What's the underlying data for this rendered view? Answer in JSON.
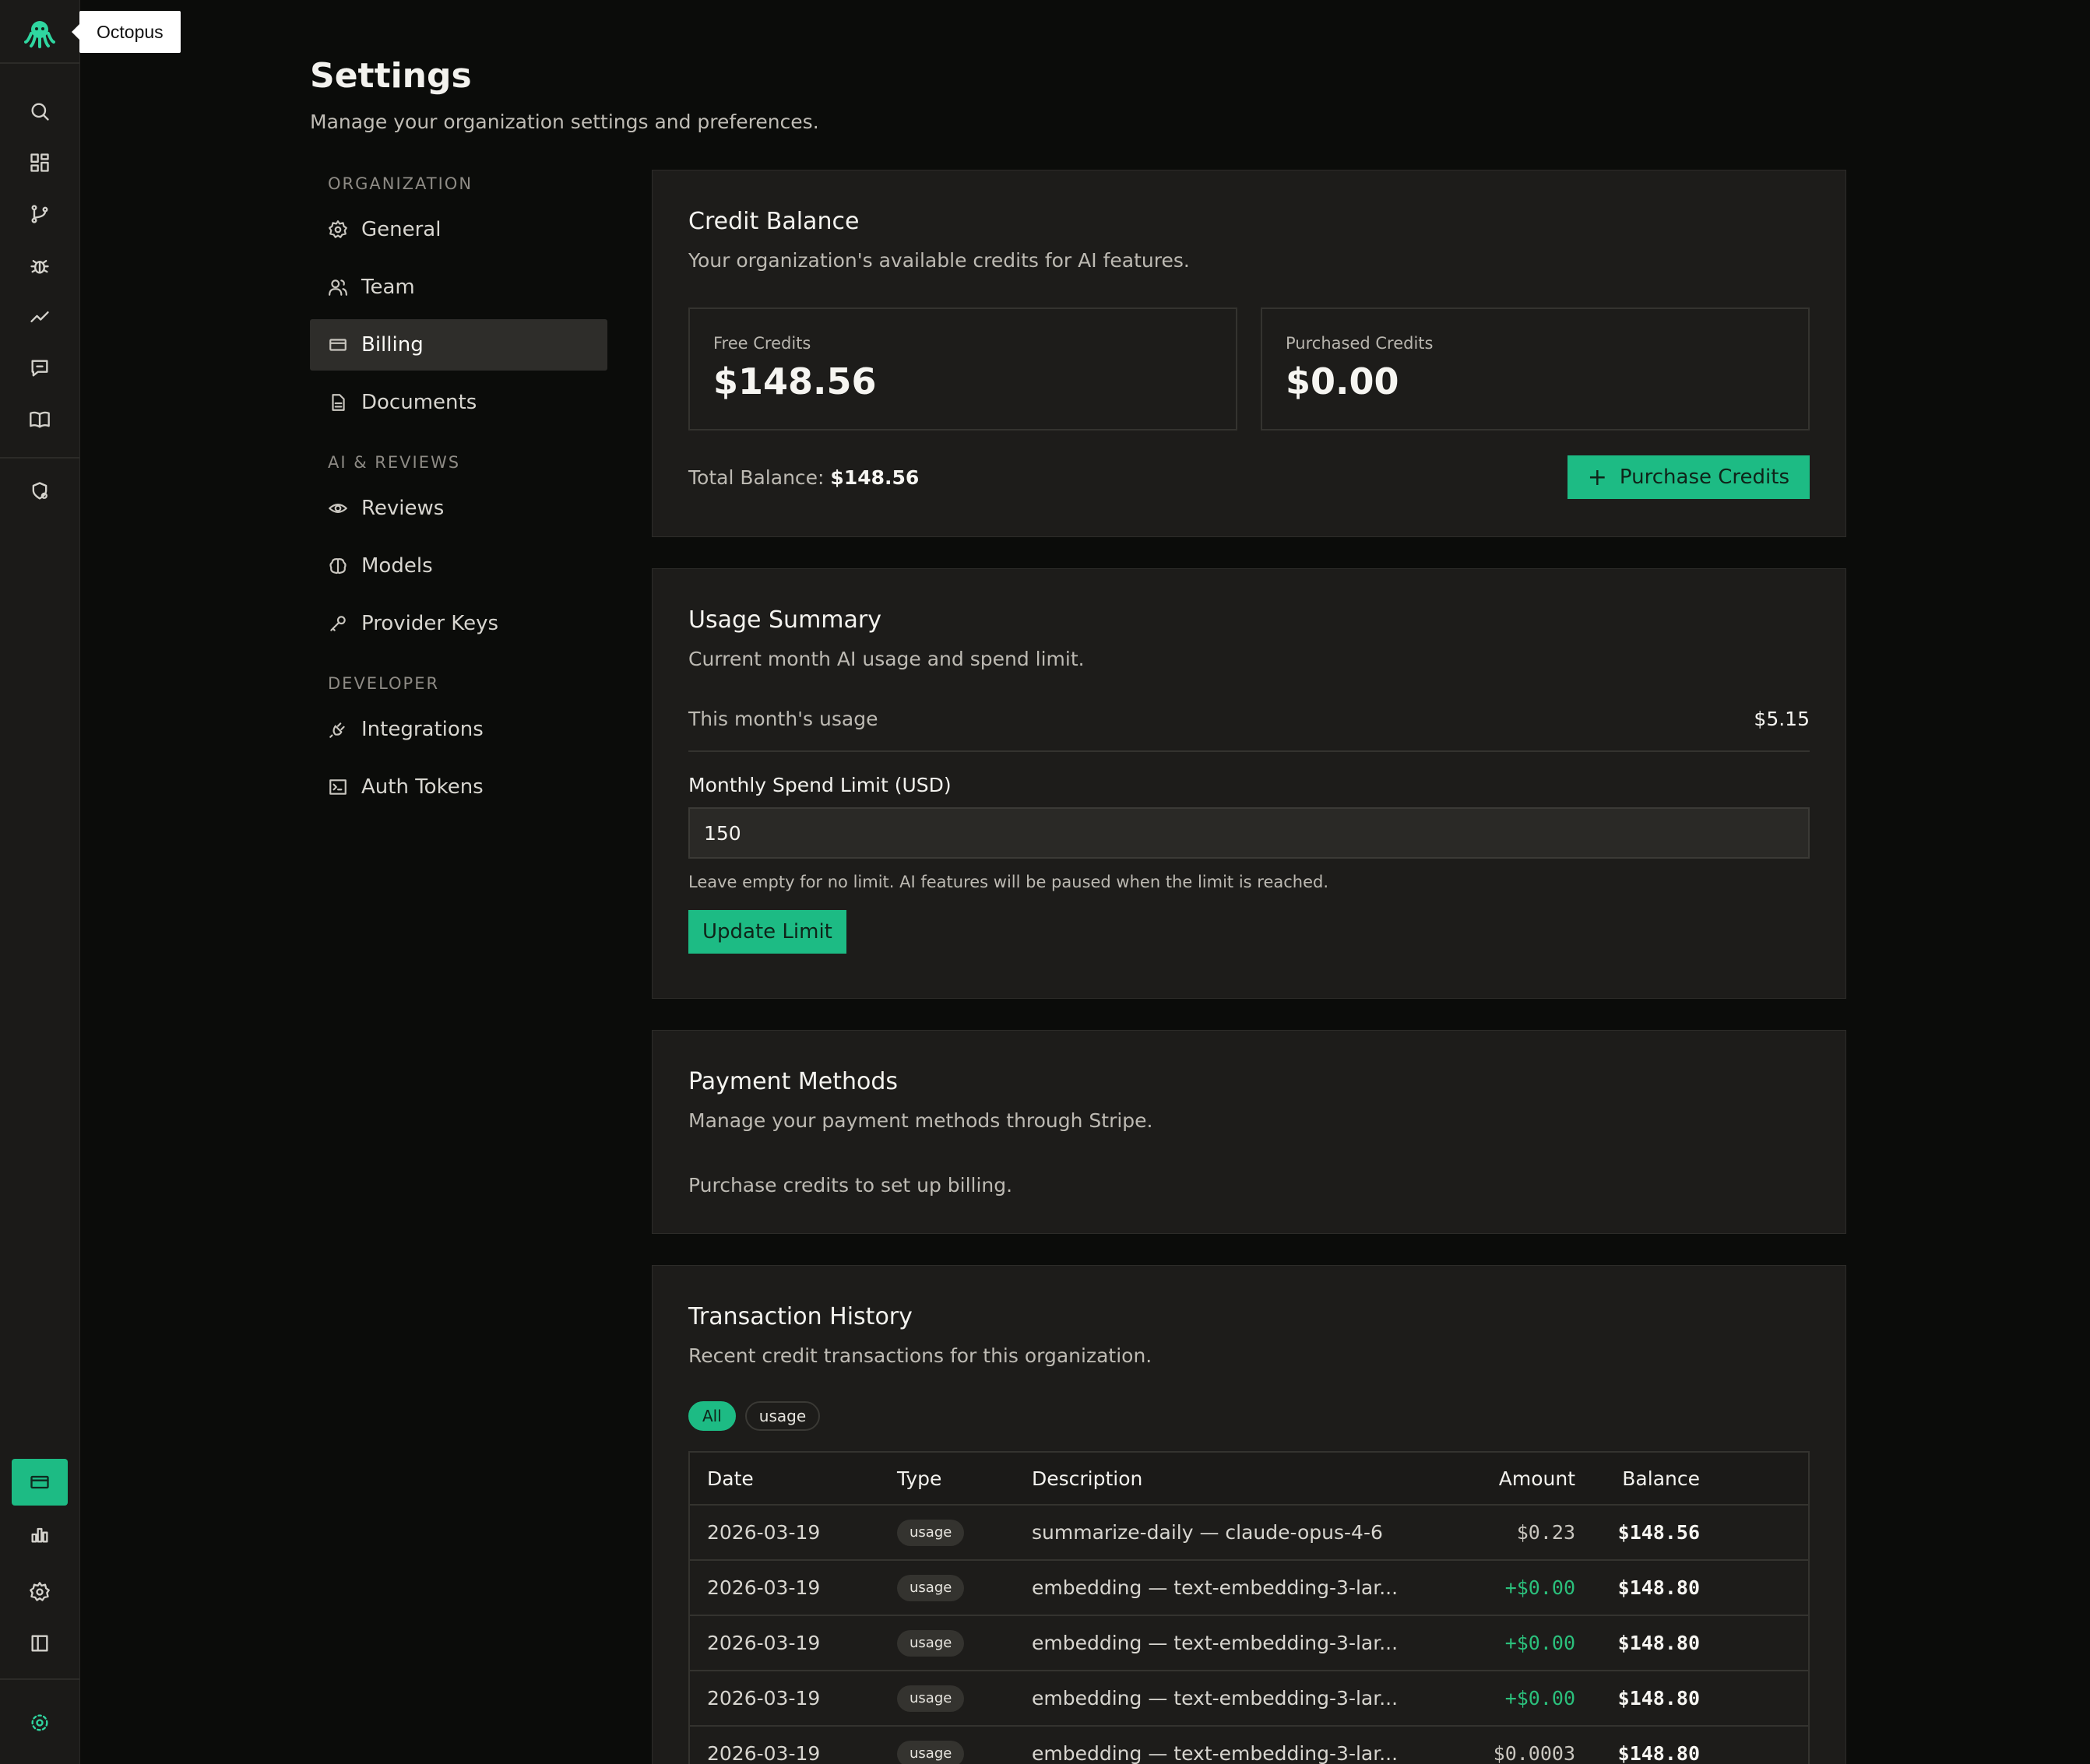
{
  "app": {
    "name": "Octopus",
    "tooltip": "Octopus"
  },
  "colors": {
    "accent": "#1dbb84",
    "positive": "#2bc07c",
    "background": "#0b0c0a",
    "card": "#1d1c1a"
  },
  "rail": {
    "items": [
      "search-icon",
      "dashboard-icon",
      "git-branch-icon",
      "bug-icon",
      "trend-icon",
      "chat-icon",
      "book-icon",
      "shield-gear-icon"
    ],
    "bottom": [
      "billing-card-icon",
      "bar-chart-icon",
      "gear-icon",
      "sidebar-panel-icon",
      "org-badge-icon"
    ]
  },
  "header": {
    "title": "Settings",
    "subtitle": "Manage your organization settings and preferences."
  },
  "nav": {
    "sections": [
      {
        "title": "ORGANIZATION",
        "items": [
          "General",
          "Team",
          "Billing",
          "Documents"
        ]
      },
      {
        "title": "AI & REVIEWS",
        "items": [
          "Reviews",
          "Models",
          "Provider Keys"
        ]
      },
      {
        "title": "DEVELOPER",
        "items": [
          "Integrations",
          "Auth Tokens"
        ]
      }
    ],
    "active": "Billing"
  },
  "credit": {
    "title": "Credit Balance",
    "desc": "Your organization's available credits for AI features.",
    "free_label": "Free Credits",
    "free_value": "$148.56",
    "purchased_label": "Purchased Credits",
    "purchased_value": "$0.00",
    "total_label": "Total Balance:",
    "total_value": "$148.56",
    "purchase_button": "Purchase Credits"
  },
  "usage": {
    "title": "Usage Summary",
    "desc": "Current month AI usage and spend limit.",
    "month_label": "This month's usage",
    "month_value": "$5.15",
    "limit_label": "Monthly Spend Limit (USD)",
    "limit_value": "150",
    "hint": "Leave empty for no limit. AI features will be paused when the limit is reached.",
    "update_button": "Update Limit"
  },
  "payment": {
    "title": "Payment Methods",
    "desc": "Manage your payment methods through Stripe.",
    "note": "Purchase credits to set up billing."
  },
  "transactions": {
    "title": "Transaction History",
    "desc": "Recent credit transactions for this organization.",
    "filters": [
      "All",
      "usage"
    ],
    "active_filter": "All",
    "columns": [
      "Date",
      "Type",
      "Description",
      "Amount",
      "Balance"
    ],
    "rows": [
      {
        "date": "2026-03-19",
        "type": "usage",
        "description": "summarize-daily — claude-opus-4-6",
        "amount": "$0.23",
        "balance": "$148.56"
      },
      {
        "date": "2026-03-19",
        "type": "usage",
        "description": "embedding — text-embedding-3-lar...",
        "amount": "+$0.00",
        "balance": "$148.80"
      },
      {
        "date": "2026-03-19",
        "type": "usage",
        "description": "embedding — text-embedding-3-lar...",
        "amount": "+$0.00",
        "balance": "$148.80"
      },
      {
        "date": "2026-03-19",
        "type": "usage",
        "description": "embedding — text-embedding-3-lar...",
        "amount": "+$0.00",
        "balance": "$148.80"
      },
      {
        "date": "2026-03-19",
        "type": "usage",
        "description": "embedding — text-embedding-3-lar...",
        "amount": "$0.0003",
        "balance": "$148.80"
      }
    ]
  }
}
